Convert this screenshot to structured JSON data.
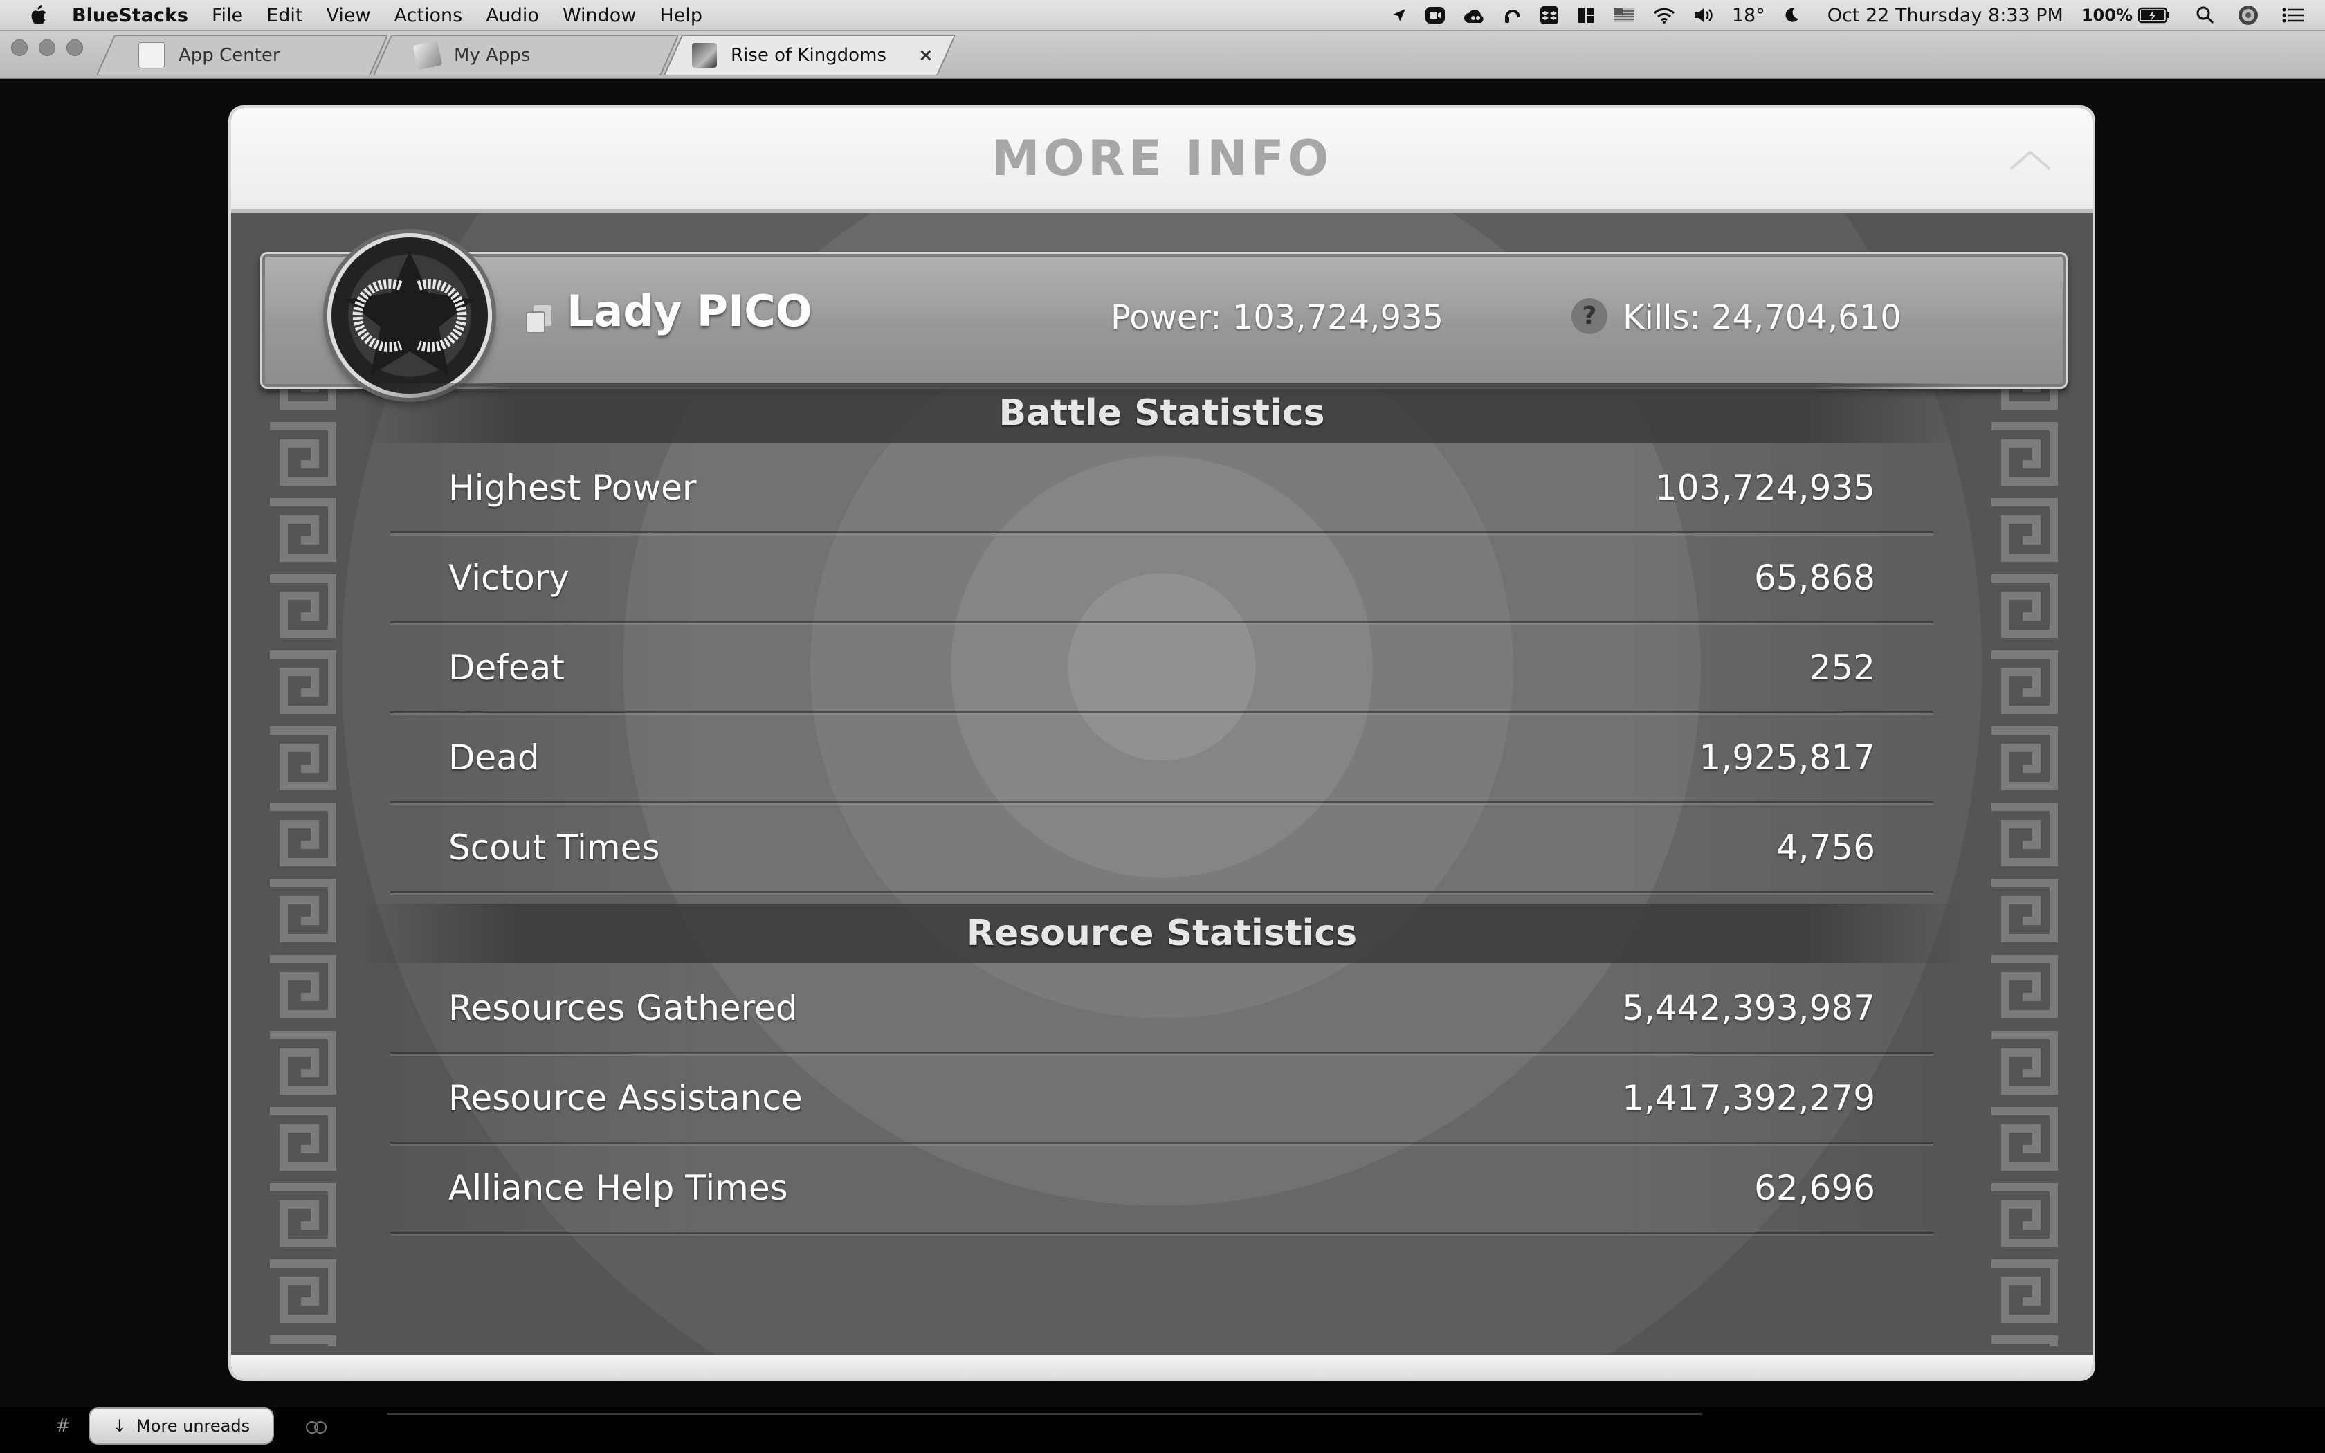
{
  "menubar": {
    "app_name": "BlueStacks",
    "menus": [
      "File",
      "Edit",
      "View",
      "Actions",
      "Audio",
      "Window",
      "Help"
    ],
    "temperature": "18°",
    "datetime": "Oct 22 Thursday 8:33 PM",
    "battery": "100%",
    "status_icons": [
      "location-icon",
      "zoom-icon",
      "creative-cloud-icon",
      "headphones-icon",
      "dropbox-icon",
      "magnet-icon",
      "flag-icon",
      "wifi-icon",
      "volume-icon",
      "moon-icon",
      "battery-icon",
      "spotlight-icon",
      "siri-icon",
      "notification-center-icon"
    ]
  },
  "tabs": {
    "app_center": "App Center",
    "my_apps": "My Apps",
    "active": "Rise of Kingdoms",
    "close_symbol": "×"
  },
  "panel": {
    "title": "MORE INFO",
    "player": {
      "name": "Lady PICO",
      "power": "Power: 103,724,935",
      "kills": "Kills: 24,704,610",
      "help_symbol": "?"
    },
    "battle_title": "Battle Statistics",
    "battle": [
      {
        "label": "Highest Power",
        "value": "103,724,935"
      },
      {
        "label": "Victory",
        "value": "65,868"
      },
      {
        "label": "Defeat",
        "value": "252"
      },
      {
        "label": "Dead",
        "value": "1,925,817"
      },
      {
        "label": "Scout Times",
        "value": "4,756"
      }
    ],
    "resource_title": "Resource Statistics",
    "resource": [
      {
        "label": "Resources Gathered",
        "value": "5,442,393,987"
      },
      {
        "label": "Resource Assistance",
        "value": "1,417,392,279"
      },
      {
        "label": "Alliance Help Times",
        "value": "62,696"
      }
    ]
  },
  "chat": {
    "channel_prefix": "#",
    "more_unreads": "More unreads",
    "arrow": "↓"
  }
}
